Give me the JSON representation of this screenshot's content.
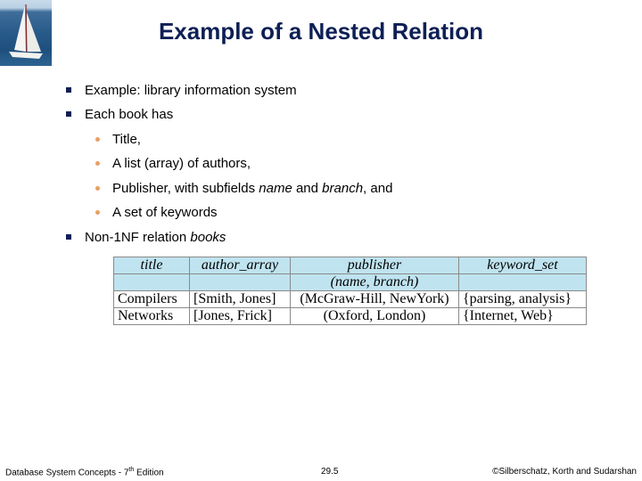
{
  "logo": {
    "icon": "sailboat-logo-icon"
  },
  "slide": {
    "title": "Example of a Nested Relation",
    "bullets": [
      {
        "level": 1,
        "marker": "square",
        "text": "Example:  library information system"
      },
      {
        "level": 1,
        "marker": "square",
        "text": "Each book has"
      },
      {
        "level": 2,
        "marker": "dot",
        "text": "Title,"
      },
      {
        "level": 2,
        "marker": "dot",
        "text": "A list (array) of authors,"
      },
      {
        "level": 2,
        "marker": "dot",
        "parts": [
          "Publisher, with subfields ",
          "name",
          " and ",
          "branch",
          ", and"
        ]
      },
      {
        "level": 2,
        "marker": "dot",
        "text": "A set of keywords"
      },
      {
        "level": 1,
        "marker": "square",
        "parts": [
          "Non-1NF relation ",
          "books"
        ]
      }
    ]
  },
  "table": {
    "headers": [
      "title",
      "author_array",
      "publisher",
      "keyword_set"
    ],
    "subheaders": [
      "",
      "",
      "(name, branch)",
      ""
    ],
    "rows": [
      [
        "Compilers",
        "[Smith, Jones]",
        "(McGraw-Hill, NewYork)",
        "{parsing, analysis}"
      ],
      [
        "Networks",
        "[Jones, Frick]",
        "(Oxford, London)",
        "{Internet, Web}"
      ]
    ]
  },
  "footer": {
    "left_prefix": "Database System Concepts - 7",
    "left_sup": "th",
    "left_suffix": " Edition",
    "center": "29.5",
    "right": "©Silberschatz, Korth and Sudarshan"
  },
  "colors": {
    "title": "#0d1f55",
    "header_fill": "#bfe3ef",
    "level2_bullet": "#e8a060",
    "level1_bullet": "#0d1f55"
  }
}
